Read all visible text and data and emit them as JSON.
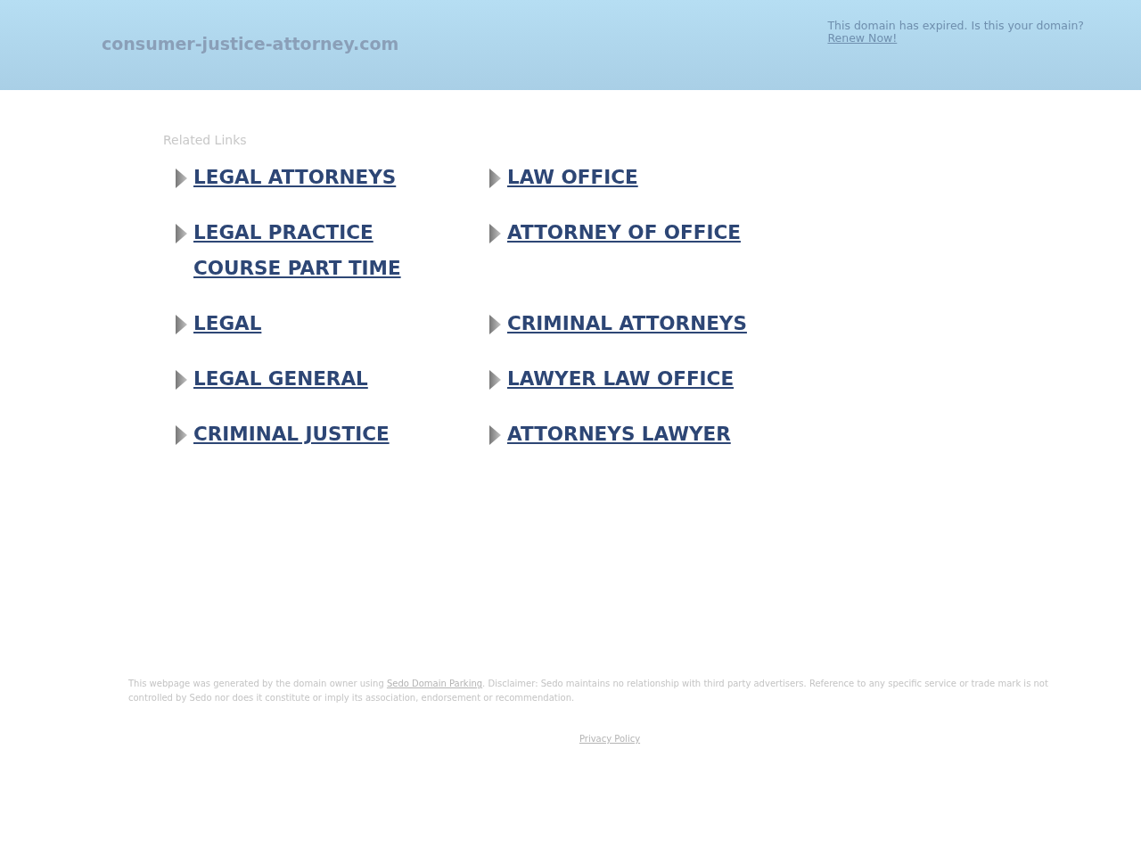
{
  "header": {
    "domain": "consumer-justice-attorney.com",
    "notice": "This domain has expired. Is this your domain?",
    "renew_link": "Renew Now!"
  },
  "related": {
    "title": "Related Links",
    "links": [
      {
        "label": "LEGAL ATTORNEYS"
      },
      {
        "label": "LAW OFFICE"
      },
      {
        "label": "LEGAL PRACTICE COURSE PART TIME"
      },
      {
        "label": "ATTORNEY OF OFFICE"
      },
      {
        "label": "LEGAL"
      },
      {
        "label": "CRIMINAL ATTORNEYS"
      },
      {
        "label": "LEGAL GENERAL"
      },
      {
        "label": "LAWYER LAW OFFICE"
      },
      {
        "label": "CRIMINAL JUSTICE"
      },
      {
        "label": "ATTORNEYS LAWYER"
      }
    ]
  },
  "footer": {
    "text_before": "This webpage was generated by the domain owner using",
    "link": "Sedo Domain Parking",
    "text_after": ". Disclaimer: Sedo maintains no relationship with third party advertisers. Reference to any specific service or trade mark is not controlled by Sedo nor does it constitute or imply its association, endorsement or recommendation.",
    "privacy": "Privacy Policy"
  }
}
